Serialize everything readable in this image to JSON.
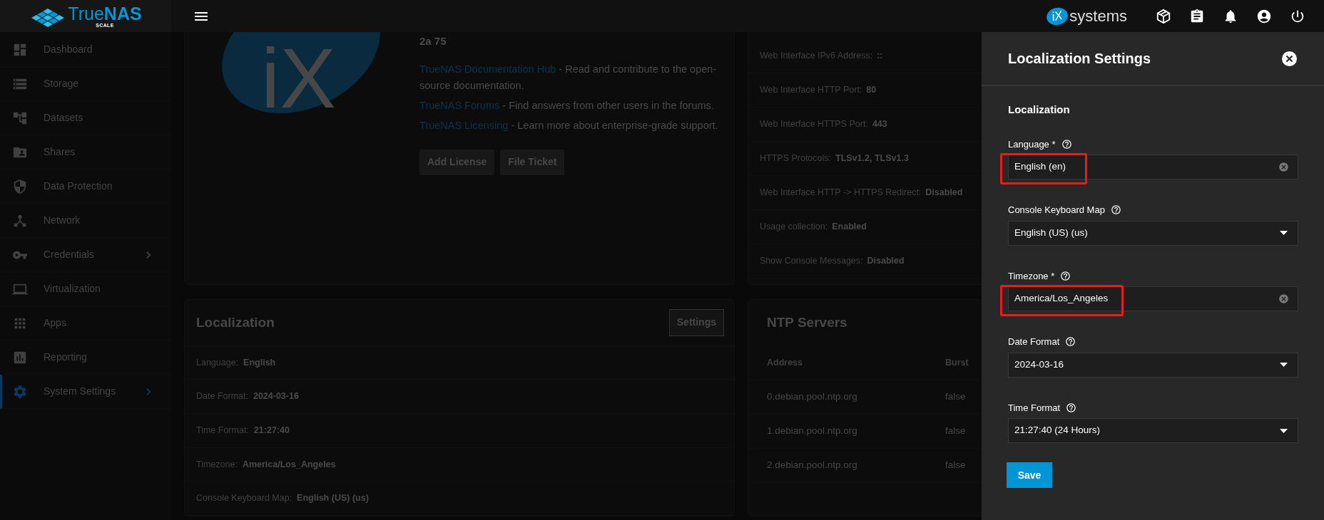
{
  "topbar": {
    "brand": {
      "name_a": "True",
      "name_b": "NAS",
      "edition": "SCALE"
    },
    "vendor": {
      "mark": "iX",
      "name": "systems"
    }
  },
  "sidebar": {
    "items": [
      {
        "label": "Dashboard",
        "selected": false,
        "expandable": false
      },
      {
        "label": "Storage",
        "selected": false,
        "expandable": false
      },
      {
        "label": "Datasets",
        "selected": false,
        "expandable": false
      },
      {
        "label": "Shares",
        "selected": false,
        "expandable": false
      },
      {
        "label": "Data Protection",
        "selected": false,
        "expandable": false
      },
      {
        "label": "Network",
        "selected": false,
        "expandable": false
      },
      {
        "label": "Credentials",
        "selected": false,
        "expandable": true
      },
      {
        "label": "Virtualization",
        "selected": false,
        "expandable": false
      },
      {
        "label": "Apps",
        "selected": false,
        "expandable": false
      },
      {
        "label": "Reporting",
        "selected": false,
        "expandable": false
      },
      {
        "label": "System Settings",
        "selected": true,
        "expandable": true
      }
    ]
  },
  "about_card": {
    "logo_text": "iX",
    "version_tail": "2a 75",
    "links": [
      {
        "link": "TrueNAS Documentation Hub",
        "text": " - Read and contribute to the open-source documentation."
      },
      {
        "link": "TrueNAS Forums",
        "text": " - Find answers from other users in the forums."
      },
      {
        "link": "TrueNAS Licensing",
        "text": " - Learn more about enterprise-grade support."
      }
    ],
    "buttons": [
      "Add License",
      "File Ticket"
    ]
  },
  "gui_card": {
    "rows": [
      {
        "label": "Web Interface IPv6 Address:",
        "value": "::"
      },
      {
        "label": "Web Interface HTTP Port:",
        "value": "80"
      },
      {
        "label": "Web Interface HTTPS Port:",
        "value": "443"
      },
      {
        "label": "HTTPS Protocols:",
        "value": "TLSv1.2, TLSv1.3"
      },
      {
        "label": "Web Interface HTTP -> HTTPS Redirect:",
        "value": "Disabled"
      },
      {
        "label": "Usage collection:",
        "value": "Enabled"
      },
      {
        "label": "Show Console Messages:",
        "value": "Disabled"
      }
    ]
  },
  "localization_card": {
    "title": "Localization",
    "button": "Settings",
    "rows": [
      {
        "label": "Language:",
        "value": "English"
      },
      {
        "label": "Date Format:",
        "value": "2024-03-16"
      },
      {
        "label": "Time Format:",
        "value": "21:27:40"
      },
      {
        "label": "Timezone:",
        "value": "America/Los_Angeles"
      },
      {
        "label": "Console Keyboard Map:",
        "value": "English (US) (us)"
      }
    ]
  },
  "ntp_card": {
    "title": "NTP Servers",
    "columns": [
      "Address",
      "Burst"
    ],
    "rows": [
      [
        "0.debian.pool.ntp.org",
        "false"
      ],
      [
        "1.debian.pool.ntp.org",
        "false"
      ],
      [
        "2.debian.pool.ntp.org",
        "false"
      ]
    ]
  },
  "panel": {
    "title": "Localization Settings",
    "section": "Localization",
    "fields": [
      {
        "label": "Language *",
        "kind": "combobox",
        "value": "English (en)",
        "highlighted": true
      },
      {
        "label": "Console Keyboard Map",
        "kind": "select",
        "value": "English (US) (us)",
        "highlighted": false
      },
      {
        "label": "Timezone *",
        "kind": "combobox",
        "value": "America/Los_Angeles",
        "highlighted": true
      },
      {
        "label": "Date Format",
        "kind": "select",
        "value": "2024-03-16",
        "highlighted": false
      },
      {
        "label": "Time Format",
        "kind": "select",
        "value": "21:27:40 (24 Hours)",
        "highlighted": false
      }
    ],
    "save": "Save"
  }
}
